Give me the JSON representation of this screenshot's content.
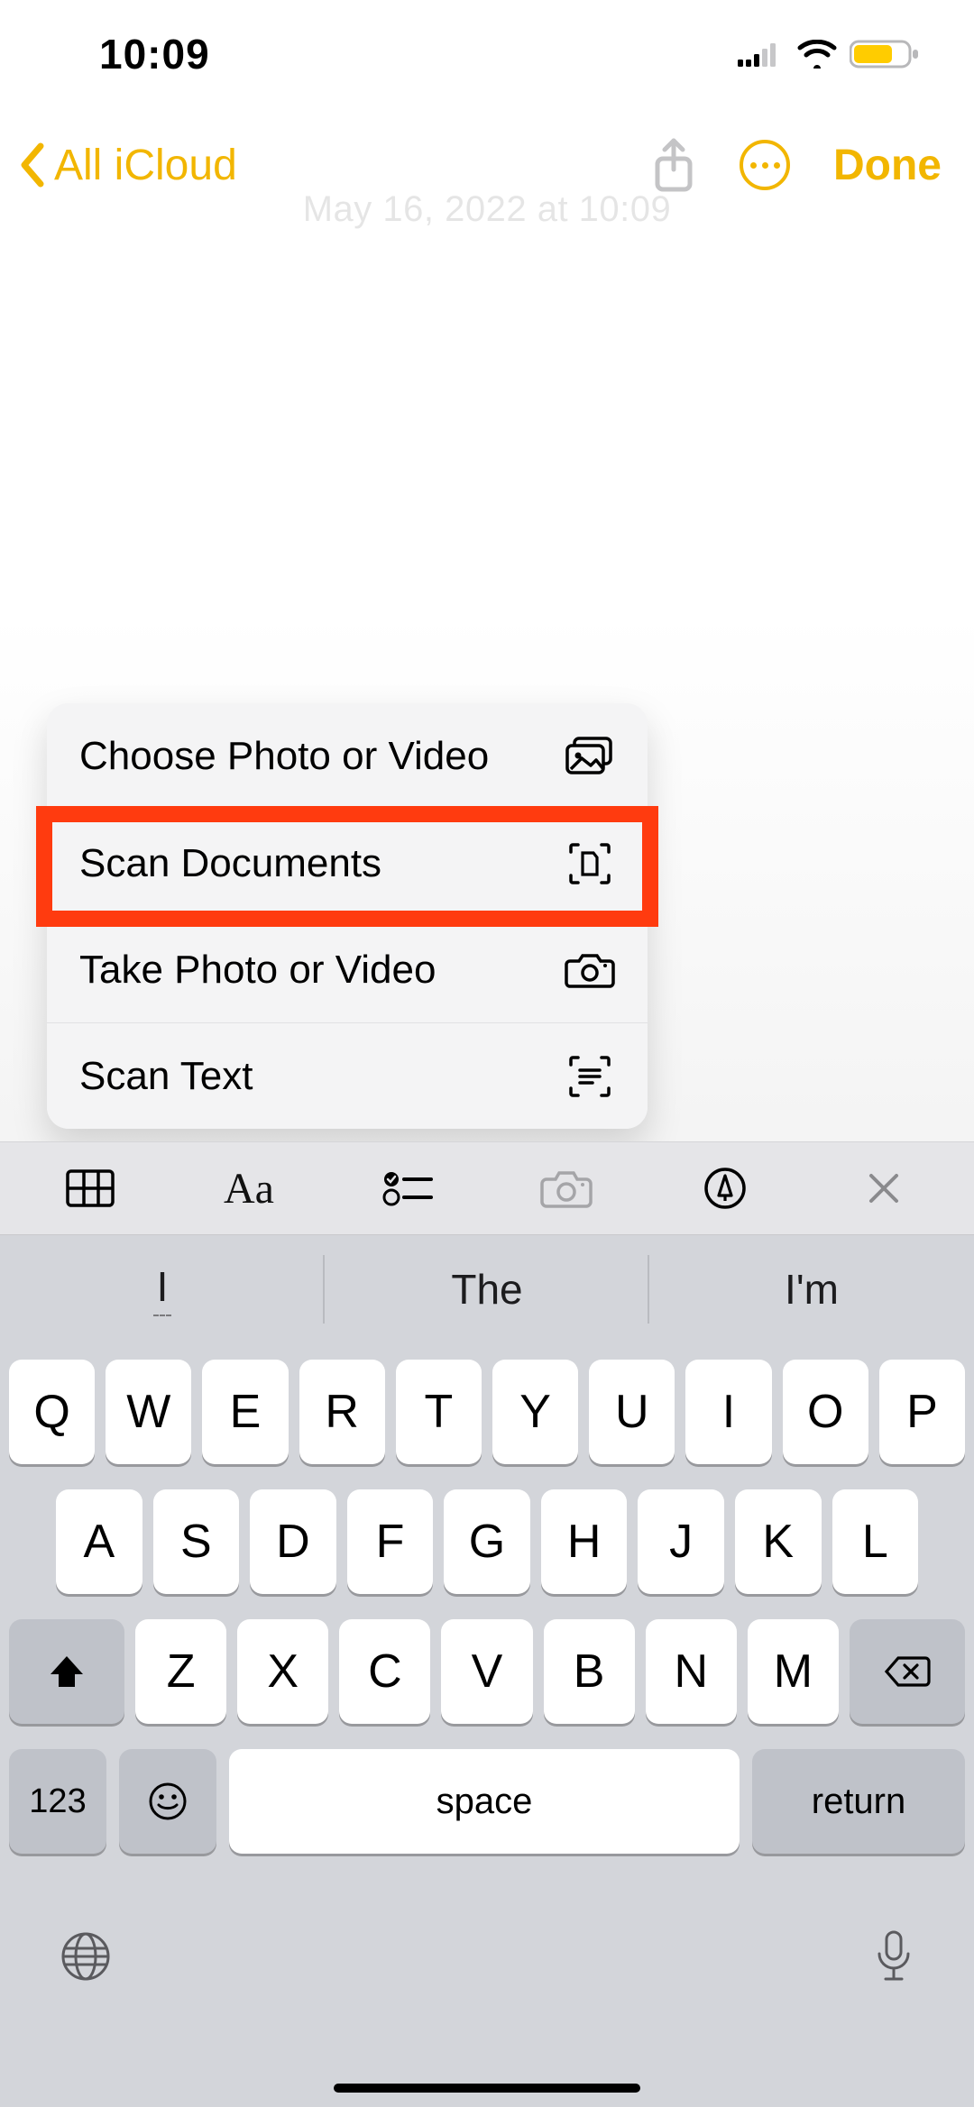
{
  "status": {
    "time": "10:09"
  },
  "nav": {
    "back_label": "All iCloud",
    "done_label": "Done"
  },
  "note": {
    "date_line": "May 16, 2022 at 10:09"
  },
  "popover": {
    "items": [
      {
        "label": "Choose Photo or Video",
        "icon": "photos-icon"
      },
      {
        "label": "Scan Documents",
        "icon": "doc-scan-icon",
        "highlighted": true
      },
      {
        "label": "Take Photo or Video",
        "icon": "camera-icon"
      },
      {
        "label": "Scan Text",
        "icon": "text-scan-icon"
      }
    ]
  },
  "format_toolbar": {
    "aa_label": "Aa"
  },
  "suggestions": {
    "items": [
      "I",
      "The",
      "I'm"
    ]
  },
  "keyboard": {
    "row1": [
      "Q",
      "W",
      "E",
      "R",
      "T",
      "Y",
      "U",
      "I",
      "O",
      "P"
    ],
    "row2": [
      "A",
      "S",
      "D",
      "F",
      "G",
      "H",
      "J",
      "K",
      "L"
    ],
    "row3": [
      "Z",
      "X",
      "C",
      "V",
      "B",
      "N",
      "M"
    ],
    "numbers_label": "123",
    "space_label": "space",
    "return_label": "return"
  }
}
